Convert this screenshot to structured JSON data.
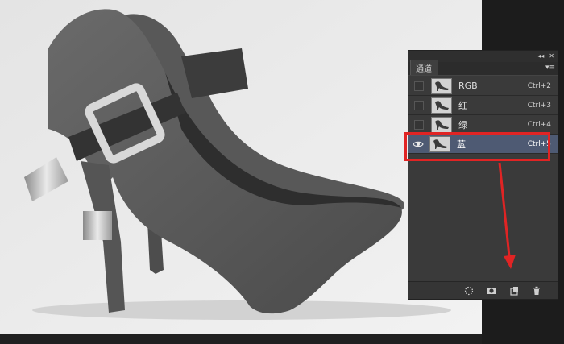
{
  "panel": {
    "collapse_label": "◂◂",
    "close_label": "✕",
    "tab_label": "通道",
    "menu_label": "▾≡",
    "channels": [
      {
        "name": "RGB",
        "shortcut": "Ctrl+2",
        "visible": false,
        "selected": false
      },
      {
        "name": "红",
        "shortcut": "Ctrl+3",
        "visible": false,
        "selected": false
      },
      {
        "name": "绿",
        "shortcut": "Ctrl+4",
        "visible": false,
        "selected": false
      },
      {
        "name": "蓝",
        "shortcut": "Ctrl+5",
        "visible": true,
        "selected": true
      }
    ]
  },
  "colors": {
    "selected_row": "#4e5a73",
    "highlight": "#e02424",
    "arrow": "#e02424",
    "panel_bg": "#3a3a3a"
  },
  "icons": [
    "dotted-circle-icon",
    "mask-icon",
    "new-channel-icon",
    "trash-icon"
  ]
}
